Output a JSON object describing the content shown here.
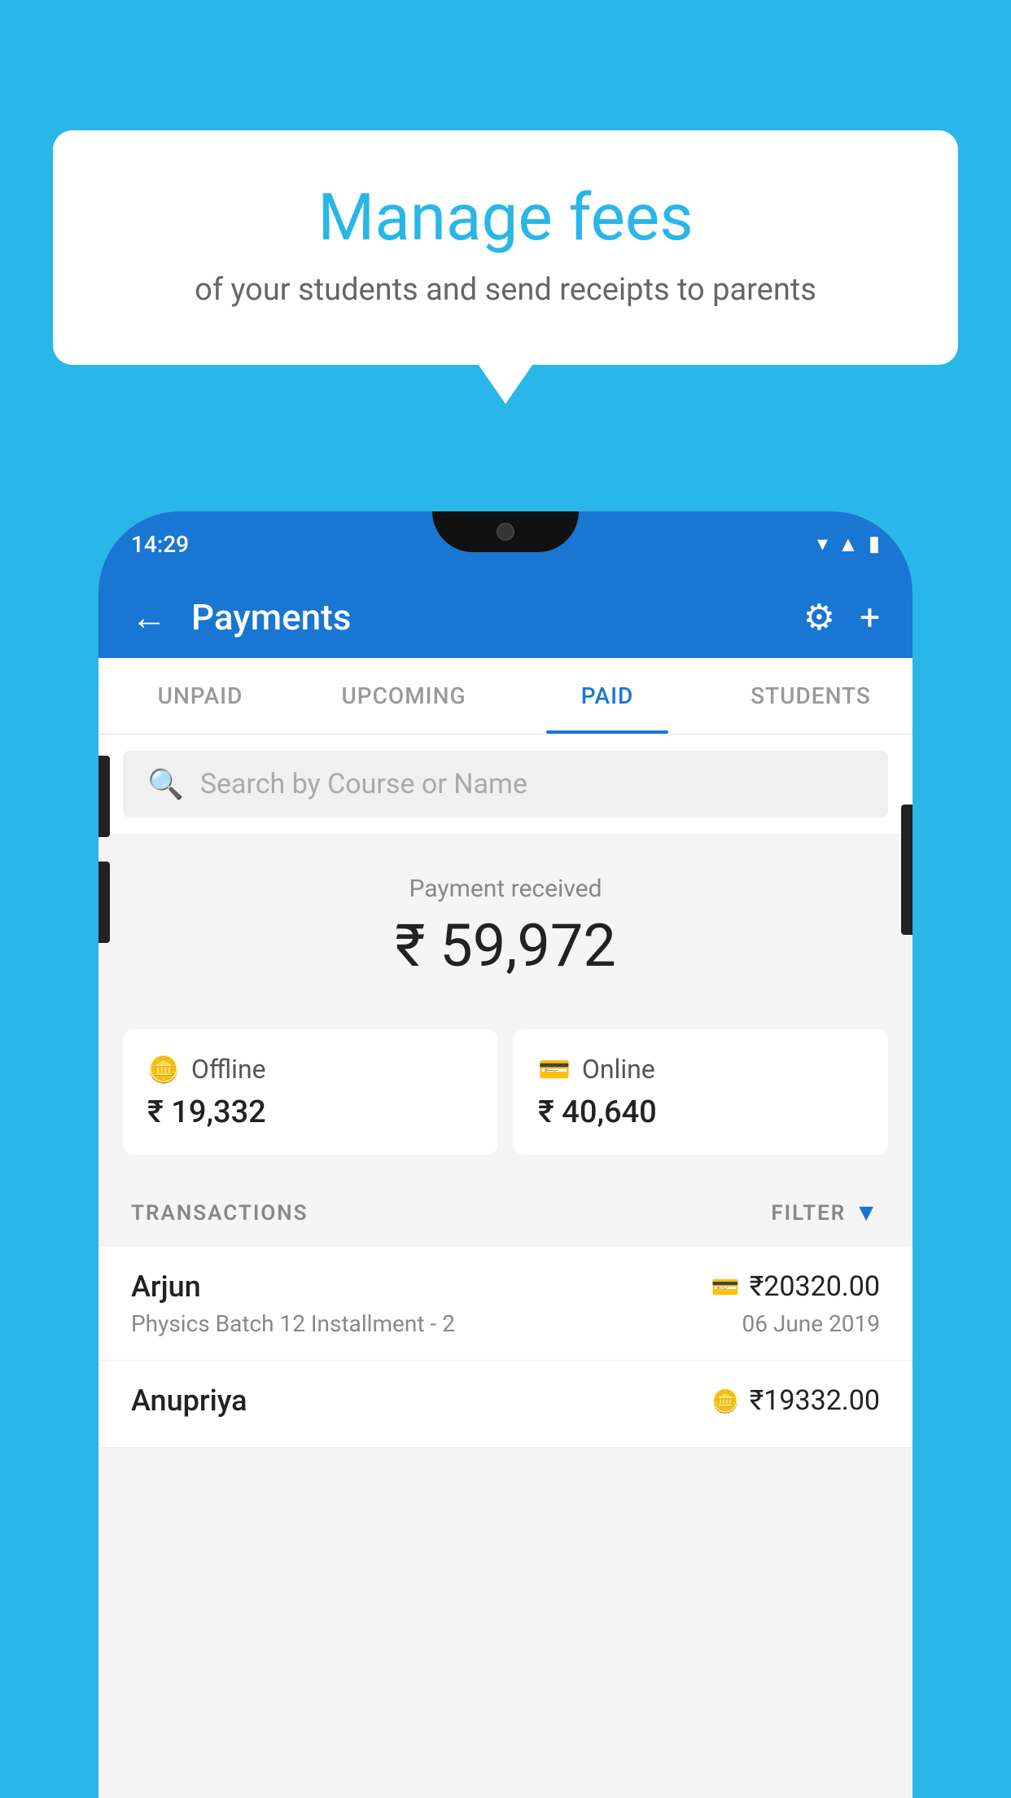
{
  "background_color": "#29b6e8",
  "bubble": {
    "title": "Manage fees",
    "subtitle": "of your students and send receipts to parents"
  },
  "phone": {
    "status_time": "14:29",
    "header": {
      "title": "Payments",
      "back_label": "←",
      "settings_label": "⚙",
      "add_label": "+"
    },
    "tabs": [
      {
        "label": "UNPAID",
        "active": false
      },
      {
        "label": "UPCOMING",
        "active": false
      },
      {
        "label": "PAID",
        "active": true
      },
      {
        "label": "STUDENTS",
        "active": false
      }
    ],
    "search": {
      "placeholder": "Search by Course or Name"
    },
    "payment_summary": {
      "label": "Payment received",
      "total": "₹ 59,972",
      "offline_label": "Offline",
      "offline_amount": "₹ 19,332",
      "online_label": "Online",
      "online_amount": "₹ 40,640"
    },
    "transactions": {
      "section_label": "TRANSACTIONS",
      "filter_label": "FILTER",
      "rows": [
        {
          "name": "Arjun",
          "amount": "₹20320.00",
          "mode": "card",
          "description": "Physics Batch 12 Installment - 2",
          "date": "06 June 2019"
        },
        {
          "name": "Anupriya",
          "amount": "₹19332.00",
          "mode": "cash",
          "description": "",
          "date": ""
        }
      ]
    }
  }
}
